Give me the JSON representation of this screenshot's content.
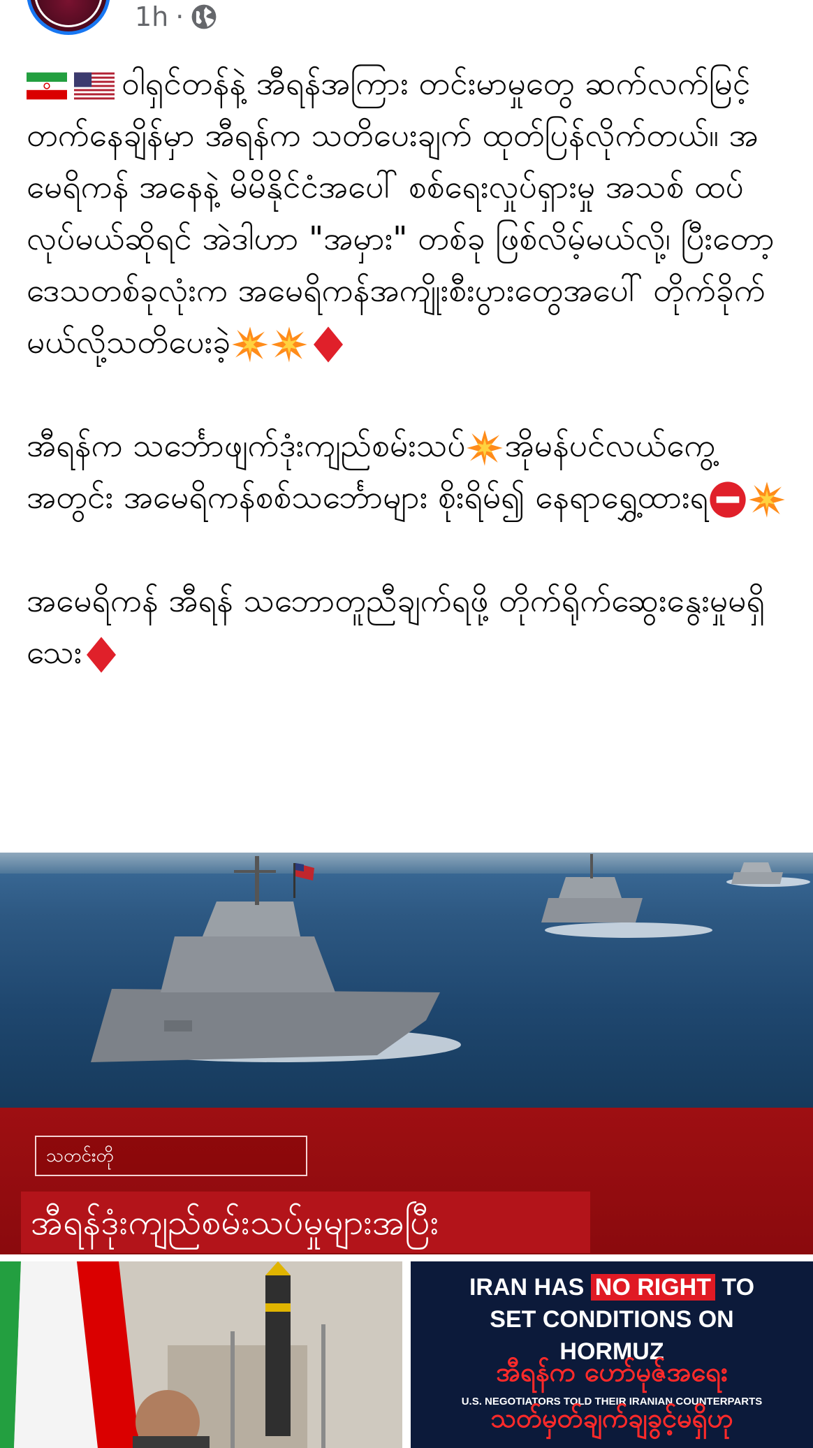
{
  "post": {
    "time": "1h",
    "separator": "·",
    "privacy_icon": "globe-icon",
    "paragraphs": [
      "ဝါရှင်တန်နဲ့ အီရန်အကြား တင်းမာမှုတွေ ဆက်လက်မြင့်တက်နေချိန်မှာ အီရန်က သတိပေးချက် ထုတ်ပြန်လိုက်တယ်။ အမေရိကန် အနေနဲ့ မိမိနိုင်ငံအပေါ် စစ်ရေးလှုပ်ရှားမှု အသစ် ထပ်လုပ်မယ်ဆိုရင် အဲဒါဟာ \"အမှား\" တစ်ခု ဖြစ်လိမ့်မယ်လို့၊ ပြီးတော့ ဒေသတစ်ခုလုံးက အမေရိကန်အကျိုးစီးပွားတွေအပေါ် တိုက်ခိုက်မယ်လို့သတိပေးခဲ့",
      "အီရန်က သင်္ဘောဖျက်ဒုံးကျည်စမ်းသပ်",
      "အိုမန်ပင်လယ်ကွေ့အတွင်း အမေရိကန်စစ်သင်္ဘောများ စိုးရိမ်၍ နေရာရွှေ့ထားရ",
      "အမေရိကန် အီရန် သဘောတူညီချက်ရဖို့ တိုက်ရိုက်ဆွေးနွေးမှုမရှိသေး"
    ]
  },
  "image_main": {
    "tag": "သတင်းတို",
    "headline": "အီရန်ဒုံးကျည်စမ်းသပ်မှုများအပြီး"
  },
  "image_right": {
    "line1_a": "IRAN HAS ",
    "line1_b": "NO RIGHT",
    "line1_c": " TO",
    "line2": "SET CONDITIONS ON",
    "line3": "HORMUZ",
    "overlay_mm_1": "အီရန်က ဟော်မုဇ်အရေး",
    "quote": "U.S. NEGOTIATORS TOLD THEIR IRANIAN COUNTERPARTS",
    "overlay_mm_2": "သတ်မှတ်ချက်ချခွင့်မရှိဟု"
  },
  "colors": {
    "accent": "#1877f2",
    "meta_text": "#65676b",
    "banner_red": "#9e0f12",
    "headline_red": "#b3141a"
  }
}
